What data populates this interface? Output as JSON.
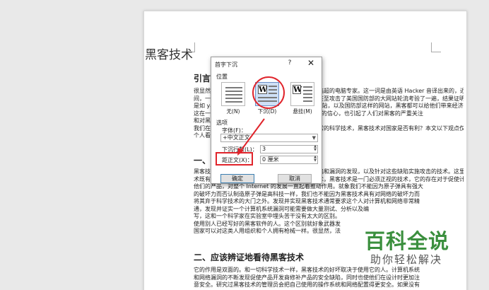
{
  "document": {
    "title": "黑客技术",
    "heading1": "引言",
    "heading2": "一、",
    "heading3": "二、应该辨证地看待黑客技术",
    "para1": [
      "很显然，黑客一词，原指热心于计算机技术，水平高超的电脑专家。这一词是由英语 Hacker 音译出来的，近段时",
      "间，一些黑客攻击各国政府网站和大型商业网站，甚至攻击了美国国防部的大网站轮流考验了一遍，结果证明即使",
      "是如 yahoo 这样具有雄厚技术支持的高性能商业网站，以及国防部这样的网站，黑客都可以给他们带来经济损失。",
      "这在一定程度上损害了人们对 Internet 和电子商务的信心，也引起了人们对黑客的严重关注",
      "和对黑客技术的思考。",
      "我们在这里要讨论的是，黑客技术是否也是一种正常的科学技术，黑客技术对国家是否有利？本文以下观点仅代表",
      "个人看法。"
    ],
    "para2": [
      "黑客技术，简单地说，是对计算机系统和网络的缺陷和漏洞的发现，以及针对这些缺陷实施攻击的技术。这里说的缺陷，包括软件缺陷、硬件缺陷、网络协议缺陷、管理缺陷和人为的失误，这一点是显而易见而无须讳言。和国防科学技术一样，黑客技",
      "术既有攻击性，也有防护的作用。作为一门科学技术，黑客技术是一门必须正视的技术，它的存在对于促使计算机和网络产品供应商不断地改善",
      "他们的产品，对整个 Internet 的发展一直起着推动作用。就象我们不能因为原子弹具有强大",
      "的破坏力而否认制造原子弹是高科技一样，我们也不能因为黑客技术具有对网络的破坏力而",
      "将其弃于科学技术的大门之外。发现并实现黑客技术通常要求这个人对计算机和网络非常精",
      "通，发现并证实一个计算机系统漏洞可能需要做大量测试、分析以及编",
      "写，这和一个科学家在实验室中埋头苦干没有太大的区别。",
      "使用别人已经写好的黑客软件的人。这个区别就好象武器发",
      "国家可以对这类人用组织和个人拥有枪械一样。很显然，法"
    ],
    "para3": [
      "它的作用是双面的。和一切科学技术一样，黑客技术的好坏取决于使用它的人。计算机系统",
      "和网络漏洞的不断发现促使产品开发商修补产品的安全缺陷，同时也使他们在设计时更加注",
      "意安全。研究过黑客技术的管理员会把自己使用的操作系统和网络配置得更安全。如果没有"
    ]
  },
  "dialog": {
    "title": "首字下沉",
    "help": "?",
    "close": "✕",
    "position_label": "位置",
    "positions": [
      {
        "label": "无(N)",
        "selected": false
      },
      {
        "label": "下沉(D)",
        "selected": true
      },
      {
        "label": "悬挂(M)",
        "selected": false
      }
    ],
    "icon_letter": "W",
    "options_label": "选项",
    "font_label": "字体(F)：",
    "font_value": "+中文正文",
    "lines_label": "下沉行数(L)：",
    "lines_value": "3",
    "distance_label": "距正文(X)：",
    "distance_value": "0 厘米",
    "ok": "确定",
    "cancel": "取消"
  },
  "watermark": {
    "main": "百科全说",
    "sub": "助你轻松解决"
  },
  "colors": {
    "highlight_red": "#e0242b",
    "watermark_green": "#3b8f3e",
    "selection_blue": "#cfe0f6"
  }
}
